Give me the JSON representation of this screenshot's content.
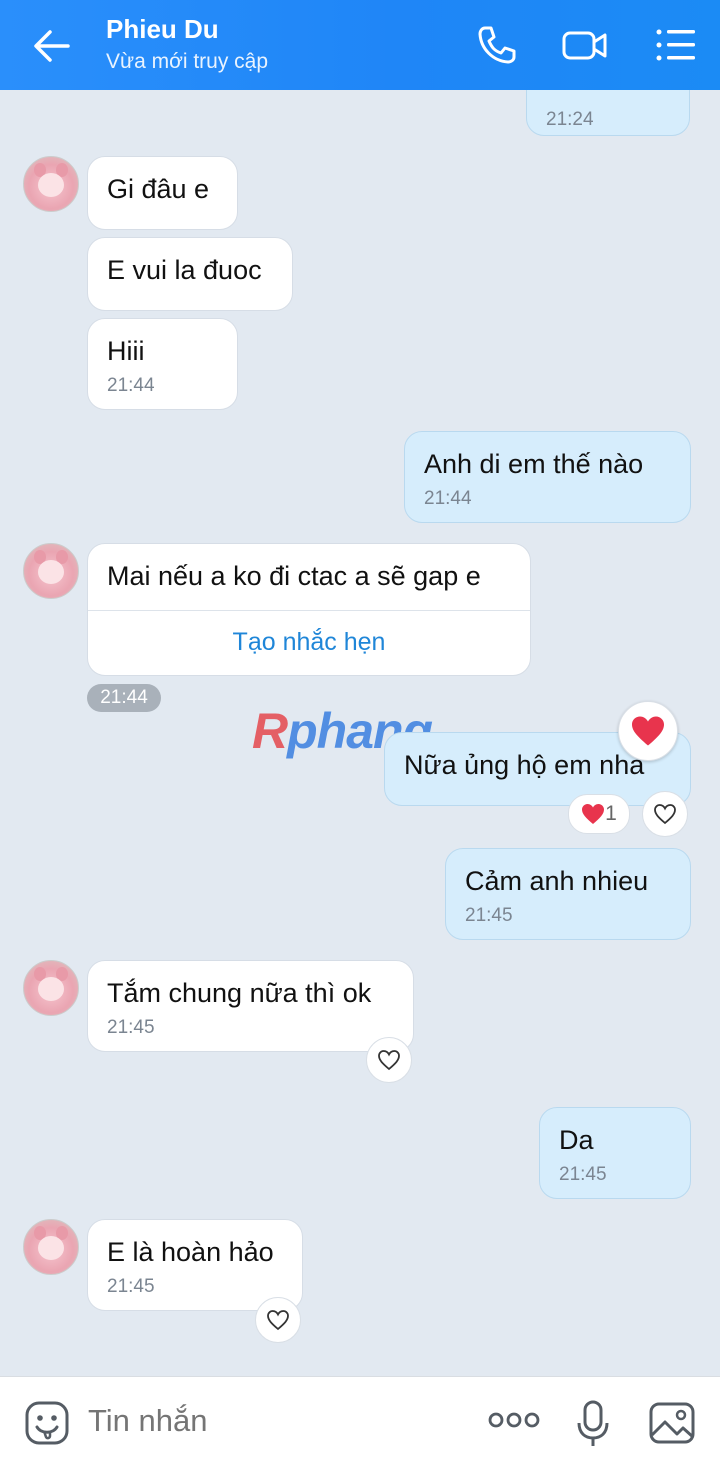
{
  "header": {
    "title": "Phieu Du",
    "subtitle": "Vừa mới truy cập"
  },
  "messages": {
    "top_time": "21:24",
    "m1": "Gi đâu e",
    "m2": "E vui la đuoc",
    "m3": "Hiii",
    "m3_time": "21:44",
    "m4": "Anh di em thế nào",
    "m4_time": "21:44",
    "m5": "Mai nếu a ko đi ctac a sẽ gap e",
    "m5_action": "Tạo nhắc hẹn",
    "m5_time": "21:44",
    "m6": "Nữa ủng hộ em nha",
    "m6_reaction_count": "1",
    "m7": "Cảm anh nhieu",
    "m7_time": "21:45",
    "m8": "Tắm chung nữa thì ok",
    "m8_time": "21:45",
    "m9": "Da",
    "m9_time": "21:45",
    "m10": "E là hoàn hảo",
    "m10_time": "21:45"
  },
  "watermark": {
    "first": "R",
    "rest": "phang"
  },
  "composer": {
    "placeholder": "Tin nhắn"
  },
  "colors": {
    "header": "#1f86f7",
    "incoming": "#ffffff",
    "outgoing": "#d6edfc",
    "background": "#e2e9f1",
    "heart": "#e8344d"
  },
  "icons": [
    "back-arrow-icon",
    "phone-icon",
    "video-icon",
    "menu-list-icon",
    "emoji-icon",
    "more-icon",
    "mic-icon",
    "image-icon",
    "heart-icon"
  ]
}
